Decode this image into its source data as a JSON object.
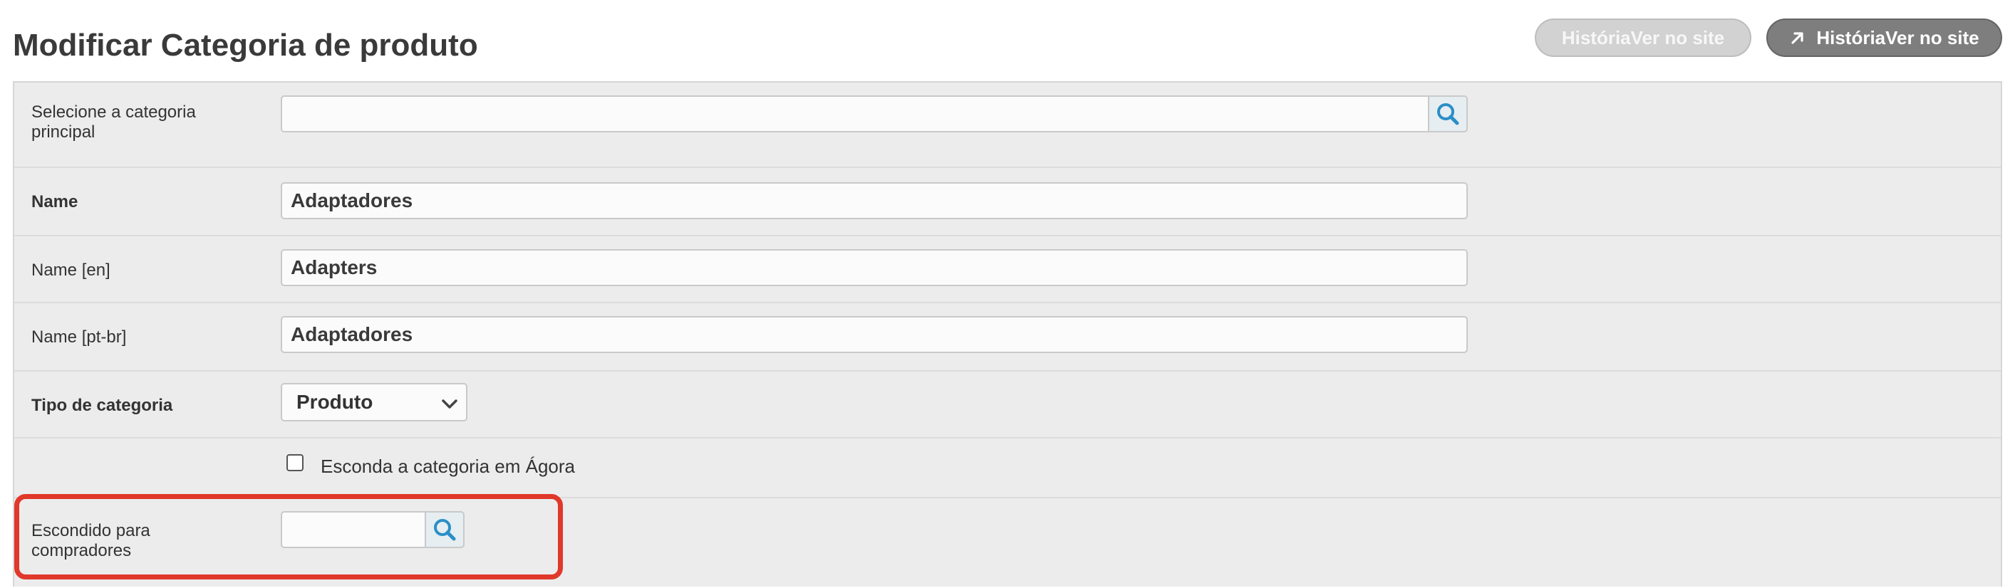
{
  "page": {
    "title": "Modificar Categoria de produto"
  },
  "header_buttons": {
    "history_label": "HistóriaVer no site",
    "view_on_site_label": "HistóriaVer no site"
  },
  "form": {
    "parent_category": {
      "label": "Selecione a categoria principal",
      "value": ""
    },
    "name": {
      "label": "Name",
      "value": "Adaptadores"
    },
    "name_en": {
      "label": "Name [en]",
      "value": "Adapters"
    },
    "name_ptbr": {
      "label": "Name [pt-br]",
      "value": "Adaptadores"
    },
    "category_type": {
      "label": "Tipo de categoria",
      "selected": "Produto"
    },
    "hide_in_agora": {
      "label": "Esconda a categoria em Ágora",
      "checked": false
    },
    "hidden_for_buyers": {
      "label": "Escondido para compradores",
      "value": ""
    }
  },
  "colors": {
    "highlight": "#e0382b",
    "panel_bg": "#ececec",
    "search_icon": "#2b8fc7"
  },
  "icons": {
    "search": "search-icon",
    "external_link": "arrow-up-right-icon",
    "select_chevron": "chevron-down-icon"
  }
}
